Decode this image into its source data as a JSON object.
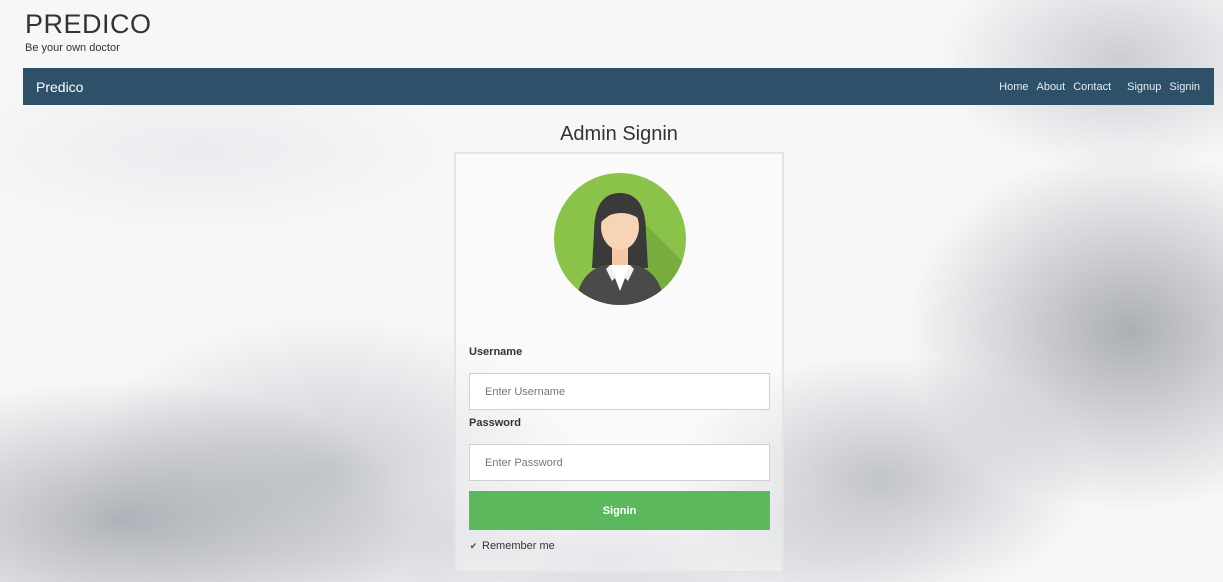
{
  "brand": {
    "title": "PREDICO",
    "tagline": "Be your own doctor"
  },
  "navbar": {
    "brand": "Predico",
    "links": [
      "Home",
      "About",
      "Contact",
      "Signup",
      "Signin"
    ],
    "background_color": "#2e5068"
  },
  "page": {
    "heading": "Admin Signin"
  },
  "form": {
    "avatar_icon": "female-user-avatar-icon",
    "username_label": "Username",
    "username_placeholder": "Enter Username",
    "password_label": "Password",
    "password_placeholder": "Enter Password",
    "submit_label": "Signin",
    "submit_color": "#5cb85c",
    "remember_label": "Remember me",
    "remember_checked": true
  }
}
